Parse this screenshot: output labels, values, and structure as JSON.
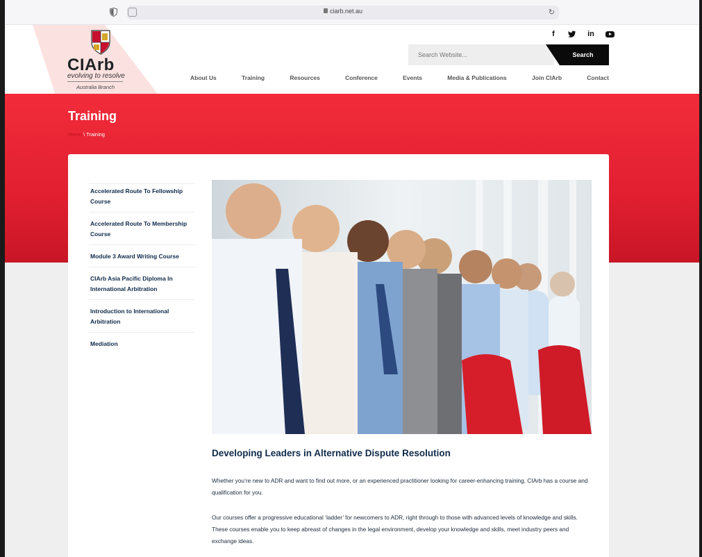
{
  "browser": {
    "url": "ciarb.net.au"
  },
  "header": {
    "brand": "CIArb",
    "tagline": "evolving to resolve",
    "branch": "Australia Branch",
    "social": [
      "f",
      "t",
      "in",
      "yt"
    ],
    "search": {
      "placeholder": "Search Website...",
      "button": "Search"
    },
    "nav": [
      "About Us",
      "Training",
      "Resources",
      "Conference",
      "Events",
      "Media & Publications",
      "Join CIArb",
      "Contact"
    ]
  },
  "hero": {
    "title": "Training",
    "breadcrumb_home": "Home",
    "breadcrumb_sep": " \\ ",
    "breadcrumb_current": "Training",
    "color": "#e8202f"
  },
  "sidebar": {
    "items": [
      "Accelerated Route To Fellowship Course",
      "Accelerated Route To Membership Course",
      "Module 3 Award Writing Course",
      "CIArb Asia Pacific Diploma In International Arbitration",
      "Introduction to International Arbitration",
      "Mediation"
    ]
  },
  "main": {
    "heading": "Developing Leaders in Alternative Dispute Resolution",
    "para1": "Whether you’re new to ADR and want to find out more, or an experienced practitioner looking for career-enhancing training, CIArb has a course and qualification for you.",
    "para2": "Our courses offer a progressive educational ‘ladder’ for newcomers to ADR, right through to those with advanced levels of knowledge and skills. These courses enable you to keep abreast of changes in the legal environment, develop your knowledge and skills, meet industry peers and exchange ideas."
  }
}
